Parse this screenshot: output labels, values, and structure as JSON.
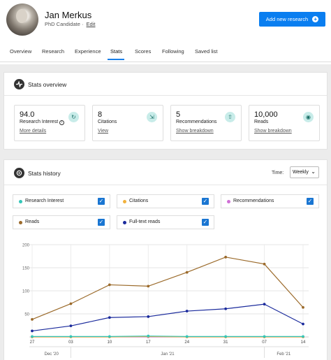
{
  "profile": {
    "name": "Jan Merkus",
    "role": "PhD Candidate · ",
    "edit_label": "Edit"
  },
  "header": {
    "add_research_label": "Add new research"
  },
  "tabs": [
    "Overview",
    "Research",
    "Experience",
    "Stats",
    "Scores",
    "Following",
    "Saved list"
  ],
  "active_tab": "Stats",
  "overview": {
    "title": "Stats overview",
    "cards": [
      {
        "value": "94.0",
        "label": "Research Interest",
        "link": "More details",
        "icon": "research-interest-icon"
      },
      {
        "value": "8",
        "label": "Citations",
        "link": "View",
        "icon": "citation-icon"
      },
      {
        "value": "5",
        "label": "Recommendations",
        "link": "Show breakdown",
        "icon": "recommendation-icon"
      },
      {
        "value": "10,000",
        "label": "Reads",
        "link": "Show breakdown",
        "icon": "eye-icon"
      }
    ]
  },
  "history": {
    "title": "Stats history",
    "time_label": "Time:",
    "time_value": "Weekly",
    "legend": [
      {
        "label": "Research Interest",
        "color": "#34c6b8",
        "checked": true
      },
      {
        "label": "Citations",
        "color": "#f1b13c",
        "checked": true
      },
      {
        "label": "Recommendations",
        "color": "#d06fd6",
        "checked": true
      },
      {
        "label": "Reads",
        "color": "#9b6a2a",
        "checked": true
      },
      {
        "label": "Full-text reads",
        "color": "#1a2a9c",
        "checked": true
      }
    ]
  },
  "chart_data": {
    "type": "line",
    "x": [
      "27",
      "03",
      "10",
      "17",
      "24",
      "31",
      "07",
      "14"
    ],
    "months": [
      "Dec '20",
      "Jan '21",
      "Feb '21"
    ],
    "yticks": [
      50,
      100,
      150,
      200
    ],
    "ylim": [
      0,
      200
    ],
    "series": [
      {
        "name": "Reads",
        "color": "#9b6a2a",
        "values": [
          38,
          72,
          113,
          110,
          140,
          173,
          158,
          64
        ]
      },
      {
        "name": "Full-text reads",
        "color": "#1a2a9c",
        "values": [
          13,
          24,
          42,
          44,
          56,
          61,
          71,
          28
        ]
      },
      {
        "name": "Research Interest",
        "color": "#34c6b8",
        "values": [
          1,
          1,
          1,
          2,
          1,
          1,
          1,
          1
        ]
      },
      {
        "name": "Citations",
        "color": "#f1b13c",
        "values": [
          0,
          0,
          0,
          1,
          0,
          0,
          0,
          0
        ]
      },
      {
        "name": "Recommendations",
        "color": "#d06fd6",
        "values": [
          0,
          0,
          0,
          0,
          0,
          0,
          0,
          0
        ]
      }
    ]
  }
}
